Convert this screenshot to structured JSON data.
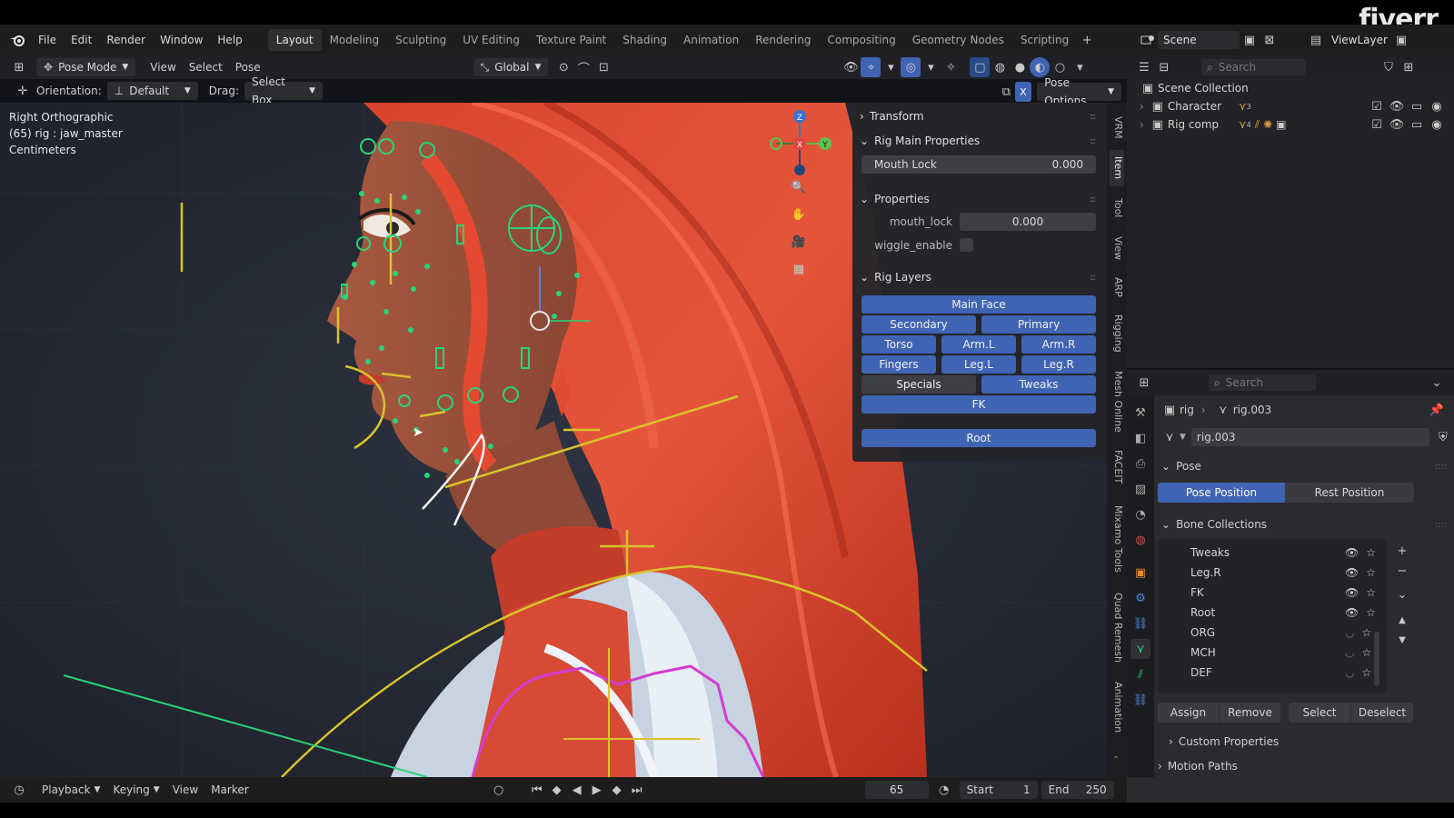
{
  "watermark": "fiverr",
  "menubar": {
    "menus": [
      "File",
      "Edit",
      "Render",
      "Window",
      "Help"
    ],
    "workspaces": [
      "Layout",
      "Modeling",
      "Sculpting",
      "UV Editing",
      "Texture Paint",
      "Shading",
      "Animation",
      "Rendering",
      "Compositing",
      "Geometry Nodes",
      "Scripting"
    ],
    "active_workspace": "Layout",
    "scene": "Scene",
    "view_layer": "ViewLayer"
  },
  "viewport_header": {
    "mode": "Pose Mode",
    "menus": [
      "View",
      "Select",
      "Pose"
    ],
    "transform_orientation": "Global",
    "orientation_label": "Orientation:",
    "orientation_value": "Default",
    "drag_label": "Drag:",
    "drag_value": "Select Box",
    "pose_options": "Pose Options",
    "x_mirror": "X"
  },
  "viewport_info": {
    "view": "Right Orthographic",
    "object": "(65) rig : jaw_master",
    "units": "Centimeters"
  },
  "npanel": {
    "transform_title": "Transform",
    "rig_main_title": "Rig Main Properties",
    "mouth_lock_label": "Mouth Lock",
    "mouth_lock_value": "0.000",
    "properties_title": "Properties",
    "prop_mouth_lock_label": "mouth_lock",
    "prop_mouth_lock_value": "0.000",
    "wiggle_label": "wiggle_enable",
    "rig_layers_title": "Rig Layers",
    "layers": {
      "main_face": "Main Face",
      "secondary": "Secondary",
      "primary": "Primary",
      "torso": "Torso",
      "arm_l": "Arm.L",
      "arm_r": "Arm.R",
      "fingers": "Fingers",
      "leg_l": "Leg.L",
      "leg_r": "Leg.R",
      "specials": "Specials",
      "tweaks": "Tweaks",
      "fk": "FK",
      "root": "Root"
    }
  },
  "vertical_tabs": [
    "VRM",
    "Item",
    "Tool",
    "View",
    "ARP",
    "Rigging",
    "Mesh Online",
    "FACEIT",
    "Mixamo Tools",
    "Quad Remesh",
    "Animation"
  ],
  "outliner": {
    "search_placeholder": "Search",
    "root": "Scene Collection",
    "items": [
      {
        "name": "Character",
        "badge": "3"
      },
      {
        "name": "Rig comp",
        "badge": "4"
      }
    ]
  },
  "properties": {
    "search_placeholder": "Search",
    "breadcrumb_object": "rig",
    "breadcrumb_armature": "rig.003",
    "data_name": "rig.003",
    "pose_title": "Pose",
    "pose_position": "Pose Position",
    "rest_position": "Rest Position",
    "bone_collections_title": "Bone Collections",
    "bone_collections": [
      {
        "name": "Tweaks",
        "visible": true
      },
      {
        "name": "Leg.R",
        "visible": true
      },
      {
        "name": "FK",
        "visible": true
      },
      {
        "name": "Root",
        "visible": true
      },
      {
        "name": "ORG",
        "visible": false
      },
      {
        "name": "MCH",
        "visible": false
      },
      {
        "name": "DEF",
        "visible": false
      }
    ],
    "assign": "Assign",
    "remove": "Remove",
    "select": "Select",
    "deselect": "Deselect",
    "custom_properties": "Custom Properties",
    "motion_paths": "Motion Paths"
  },
  "timeline": {
    "menus": [
      "Playback",
      "Keying",
      "View",
      "Marker"
    ],
    "current_frame": "65",
    "start_label": "Start",
    "start": "1",
    "end_label": "End",
    "end": "250"
  },
  "colors": {
    "accent_blue": "#3f64b3",
    "bone_green": "#2ad37a",
    "bone_yellow": "#d8c42a",
    "hair_red": "#e2432a"
  }
}
